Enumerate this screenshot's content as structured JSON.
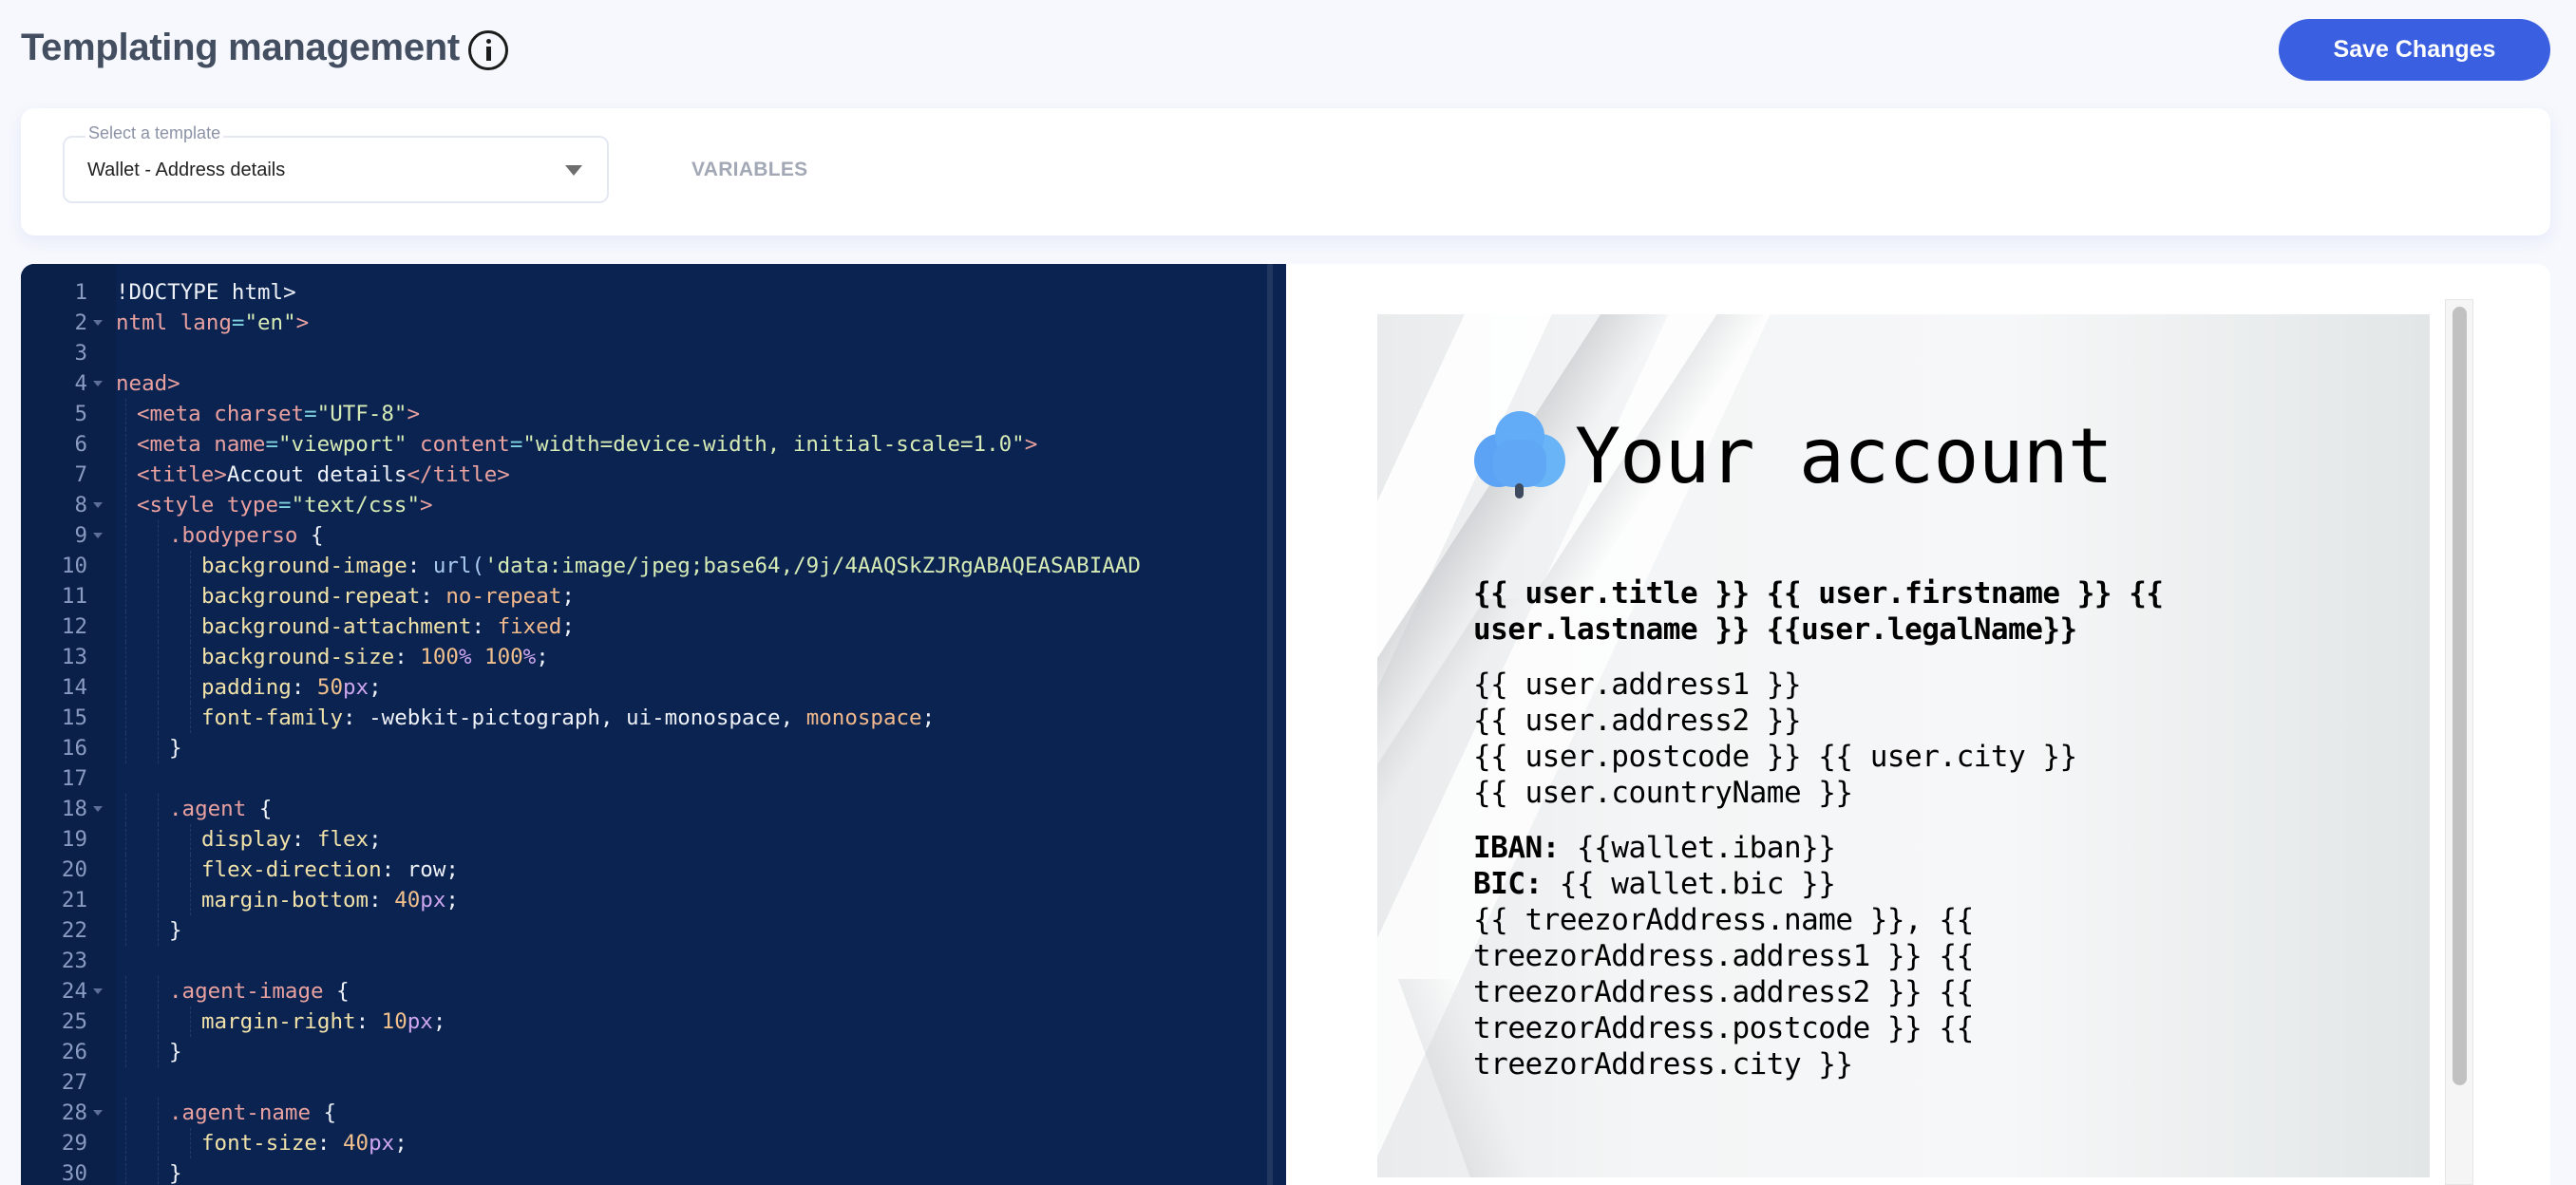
{
  "header": {
    "title": "Templating management",
    "info_icon": "info-circle-icon",
    "save_label": "Save Changes",
    "accent_color": "#3a5fe0"
  },
  "template_selector": {
    "label": "Select a template",
    "value": "Wallet - Address details",
    "variables_label": "VARIABLES"
  },
  "editor": {
    "background": "#0b2350",
    "lines": [
      {
        "n": "1",
        "fold": false,
        "indent": 0,
        "tokens": [
          [
            "plain",
            "!DOCTYPE html>"
          ]
        ]
      },
      {
        "n": "2",
        "fold": true,
        "indent": 0,
        "tokens": [
          [
            "tag",
            "ntml "
          ],
          [
            "tag",
            "lang"
          ],
          [
            "eq",
            "="
          ],
          [
            "str",
            "\"en\""
          ],
          [
            "tag",
            ">"
          ]
        ]
      },
      {
        "n": "3",
        "fold": false,
        "indent": 0,
        "tokens": []
      },
      {
        "n": "4",
        "fold": true,
        "indent": 0,
        "tokens": [
          [
            "tag",
            "nead>"
          ]
        ]
      },
      {
        "n": "5",
        "fold": false,
        "indent": 1,
        "tokens": [
          [
            "tag",
            "<meta "
          ],
          [
            "tag",
            "charset"
          ],
          [
            "eq",
            "="
          ],
          [
            "str",
            "\"UTF-8\""
          ],
          [
            "tag",
            ">"
          ]
        ]
      },
      {
        "n": "6",
        "fold": false,
        "indent": 1,
        "tokens": [
          [
            "tag",
            "<meta "
          ],
          [
            "tag",
            "name"
          ],
          [
            "eq",
            "="
          ],
          [
            "str",
            "\"viewport\""
          ],
          [
            "plain",
            " "
          ],
          [
            "tag",
            "content"
          ],
          [
            "eq",
            "="
          ],
          [
            "str",
            "\"width=device-width, initial-scale=1.0\""
          ],
          [
            "tag",
            ">"
          ]
        ]
      },
      {
        "n": "7",
        "fold": false,
        "indent": 1,
        "tokens": [
          [
            "tag",
            "<title>"
          ],
          [
            "plain",
            "Accout details"
          ],
          [
            "tag",
            "</title>"
          ]
        ]
      },
      {
        "n": "8",
        "fold": true,
        "indent": 1,
        "tokens": [
          [
            "tag",
            "<style "
          ],
          [
            "tag",
            "type"
          ],
          [
            "eq",
            "="
          ],
          [
            "str",
            "\"text/css\""
          ],
          [
            "tag",
            ">"
          ]
        ]
      },
      {
        "n": "9",
        "fold": true,
        "indent": 2,
        "tokens": [
          [
            "sel",
            ".bodyperso"
          ],
          [
            "plain",
            " {"
          ]
        ]
      },
      {
        "n": "10",
        "fold": false,
        "indent": 3,
        "tokens": [
          [
            "prop",
            "background-image"
          ],
          [
            "plain",
            ": "
          ],
          [
            "fn",
            "url("
          ],
          [
            "str",
            "'data:image/jpeg;base64,/9j/4AAQSkZJRgABAQEASABIAAD"
          ]
        ]
      },
      {
        "n": "11",
        "fold": false,
        "indent": 3,
        "tokens": [
          [
            "prop",
            "background-repeat"
          ],
          [
            "plain",
            ": "
          ],
          [
            "val",
            "no-repeat"
          ],
          [
            "plain",
            ";"
          ]
        ]
      },
      {
        "n": "12",
        "fold": false,
        "indent": 3,
        "tokens": [
          [
            "prop",
            "background-attachment"
          ],
          [
            "plain",
            ": "
          ],
          [
            "val",
            "fixed"
          ],
          [
            "plain",
            ";"
          ]
        ]
      },
      {
        "n": "13",
        "fold": false,
        "indent": 3,
        "tokens": [
          [
            "prop",
            "background-size"
          ],
          [
            "plain",
            ": "
          ],
          [
            "num",
            "100"
          ],
          [
            "unit",
            "%"
          ],
          [
            "plain",
            " "
          ],
          [
            "num",
            "100"
          ],
          [
            "unit",
            "%"
          ],
          [
            "plain",
            ";"
          ]
        ]
      },
      {
        "n": "14",
        "fold": false,
        "indent": 3,
        "tokens": [
          [
            "prop",
            "padding"
          ],
          [
            "plain",
            ": "
          ],
          [
            "num",
            "50"
          ],
          [
            "unit",
            "px"
          ],
          [
            "plain",
            ";"
          ]
        ]
      },
      {
        "n": "15",
        "fold": false,
        "indent": 3,
        "tokens": [
          [
            "prop",
            "font-family"
          ],
          [
            "plain",
            ": -webkit-pictograph, ui-monospace, "
          ],
          [
            "val",
            "monospace"
          ],
          [
            "plain",
            ";"
          ]
        ]
      },
      {
        "n": "16",
        "fold": false,
        "indent": 2,
        "tokens": [
          [
            "plain",
            "}"
          ]
        ]
      },
      {
        "n": "17",
        "fold": false,
        "indent": 0,
        "tokens": []
      },
      {
        "n": "18",
        "fold": true,
        "indent": 2,
        "tokens": [
          [
            "sel",
            ".agent"
          ],
          [
            "plain",
            " {"
          ]
        ]
      },
      {
        "n": "19",
        "fold": false,
        "indent": 3,
        "tokens": [
          [
            "prop",
            "display"
          ],
          [
            "plain",
            ": "
          ],
          [
            "prop",
            "flex"
          ],
          [
            "plain",
            ";"
          ]
        ]
      },
      {
        "n": "20",
        "fold": false,
        "indent": 3,
        "tokens": [
          [
            "prop",
            "flex-direction"
          ],
          [
            "plain",
            ": row;"
          ]
        ]
      },
      {
        "n": "21",
        "fold": false,
        "indent": 3,
        "tokens": [
          [
            "prop",
            "margin-bottom"
          ],
          [
            "plain",
            ": "
          ],
          [
            "num",
            "40"
          ],
          [
            "unit",
            "px"
          ],
          [
            "plain",
            ";"
          ]
        ]
      },
      {
        "n": "22",
        "fold": false,
        "indent": 2,
        "tokens": [
          [
            "plain",
            "}"
          ]
        ]
      },
      {
        "n": "23",
        "fold": false,
        "indent": 0,
        "tokens": []
      },
      {
        "n": "24",
        "fold": true,
        "indent": 2,
        "tokens": [
          [
            "sel",
            ".agent-image"
          ],
          [
            "plain",
            " {"
          ]
        ]
      },
      {
        "n": "25",
        "fold": false,
        "indent": 3,
        "tokens": [
          [
            "prop",
            "margin-right"
          ],
          [
            "plain",
            ": "
          ],
          [
            "num",
            "10"
          ],
          [
            "unit",
            "px"
          ],
          [
            "plain",
            ";"
          ]
        ]
      },
      {
        "n": "26",
        "fold": false,
        "indent": 2,
        "tokens": [
          [
            "plain",
            "}"
          ]
        ]
      },
      {
        "n": "27",
        "fold": false,
        "indent": 0,
        "tokens": []
      },
      {
        "n": "28",
        "fold": true,
        "indent": 2,
        "tokens": [
          [
            "sel",
            ".agent-name"
          ],
          [
            "plain",
            " {"
          ]
        ]
      },
      {
        "n": "29",
        "fold": false,
        "indent": 3,
        "tokens": [
          [
            "prop",
            "font-size"
          ],
          [
            "plain",
            ": "
          ],
          [
            "num",
            "40"
          ],
          [
            "unit",
            "px"
          ],
          [
            "plain",
            ";"
          ]
        ]
      },
      {
        "n": "30",
        "fold": false,
        "indent": 2,
        "tokens": [
          [
            "plain",
            "}"
          ]
        ]
      }
    ]
  },
  "preview": {
    "logo_icon": "tree-icon",
    "title": "Your account",
    "name_line": "{{ user.title }} {{ user.firstname }} {{ user.lastname }} {{user.legalName}}",
    "address_lines": [
      "{{ user.address1 }}",
      "{{ user.address2 }}",
      "{{ user.postcode }} {{ user.city }}",
      "{{ user.countryName }}"
    ],
    "iban_label": "IBAN:",
    "iban_value": " {{wallet.iban}}",
    "bic_label": "BIC:",
    "bic_value": " {{ wallet.bic }}",
    "treezor_address": "{{ treezorAddress.name }}, {{ treezorAddress.address1 }} {{ treezorAddress.address2 }} {{ treezorAddress.postcode }} {{ treezorAddress.city }}"
  }
}
